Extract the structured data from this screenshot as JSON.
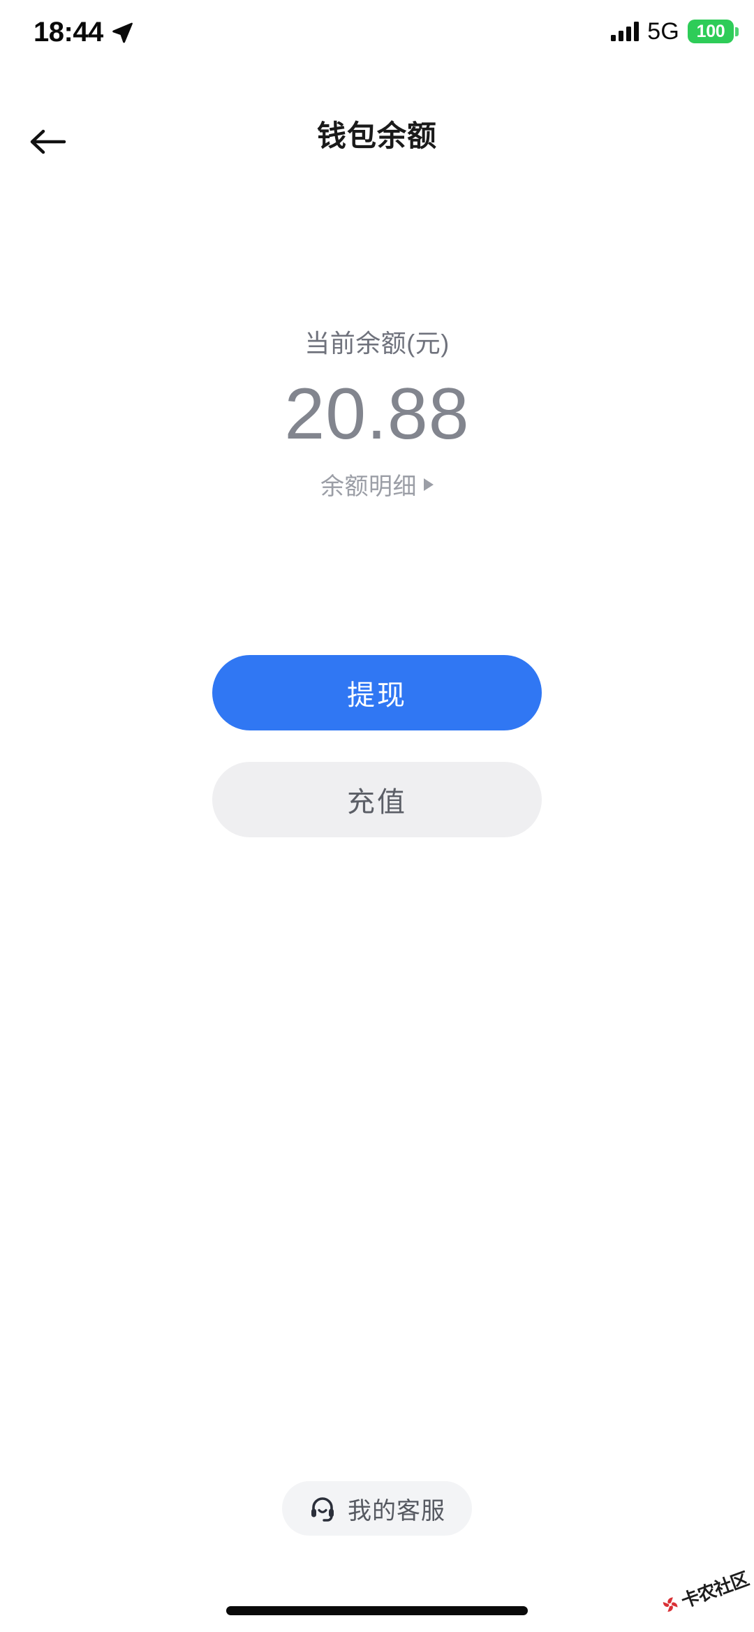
{
  "status_bar": {
    "time": "18:44",
    "location_icon": "location-arrow-icon",
    "signal_icon": "cellular-signal-icon",
    "network_type": "5G",
    "battery_percent": "100",
    "battery_color": "#2ecc58"
  },
  "nav": {
    "back_icon": "back-arrow-icon",
    "title": "钱包余额"
  },
  "balance": {
    "label": "当前余额(元)",
    "amount": "20.88",
    "detail_link": "余额明细",
    "detail_caret_icon": "caret-right-icon"
  },
  "actions": {
    "withdraw_label": "提现",
    "recharge_label": "充值",
    "primary_color": "#3077f3",
    "secondary_color": "#efeff1"
  },
  "customer_service": {
    "icon": "headset-icon",
    "label": "我的客服"
  },
  "watermark": {
    "text": "卡农社区",
    "color": "#d8272c"
  }
}
